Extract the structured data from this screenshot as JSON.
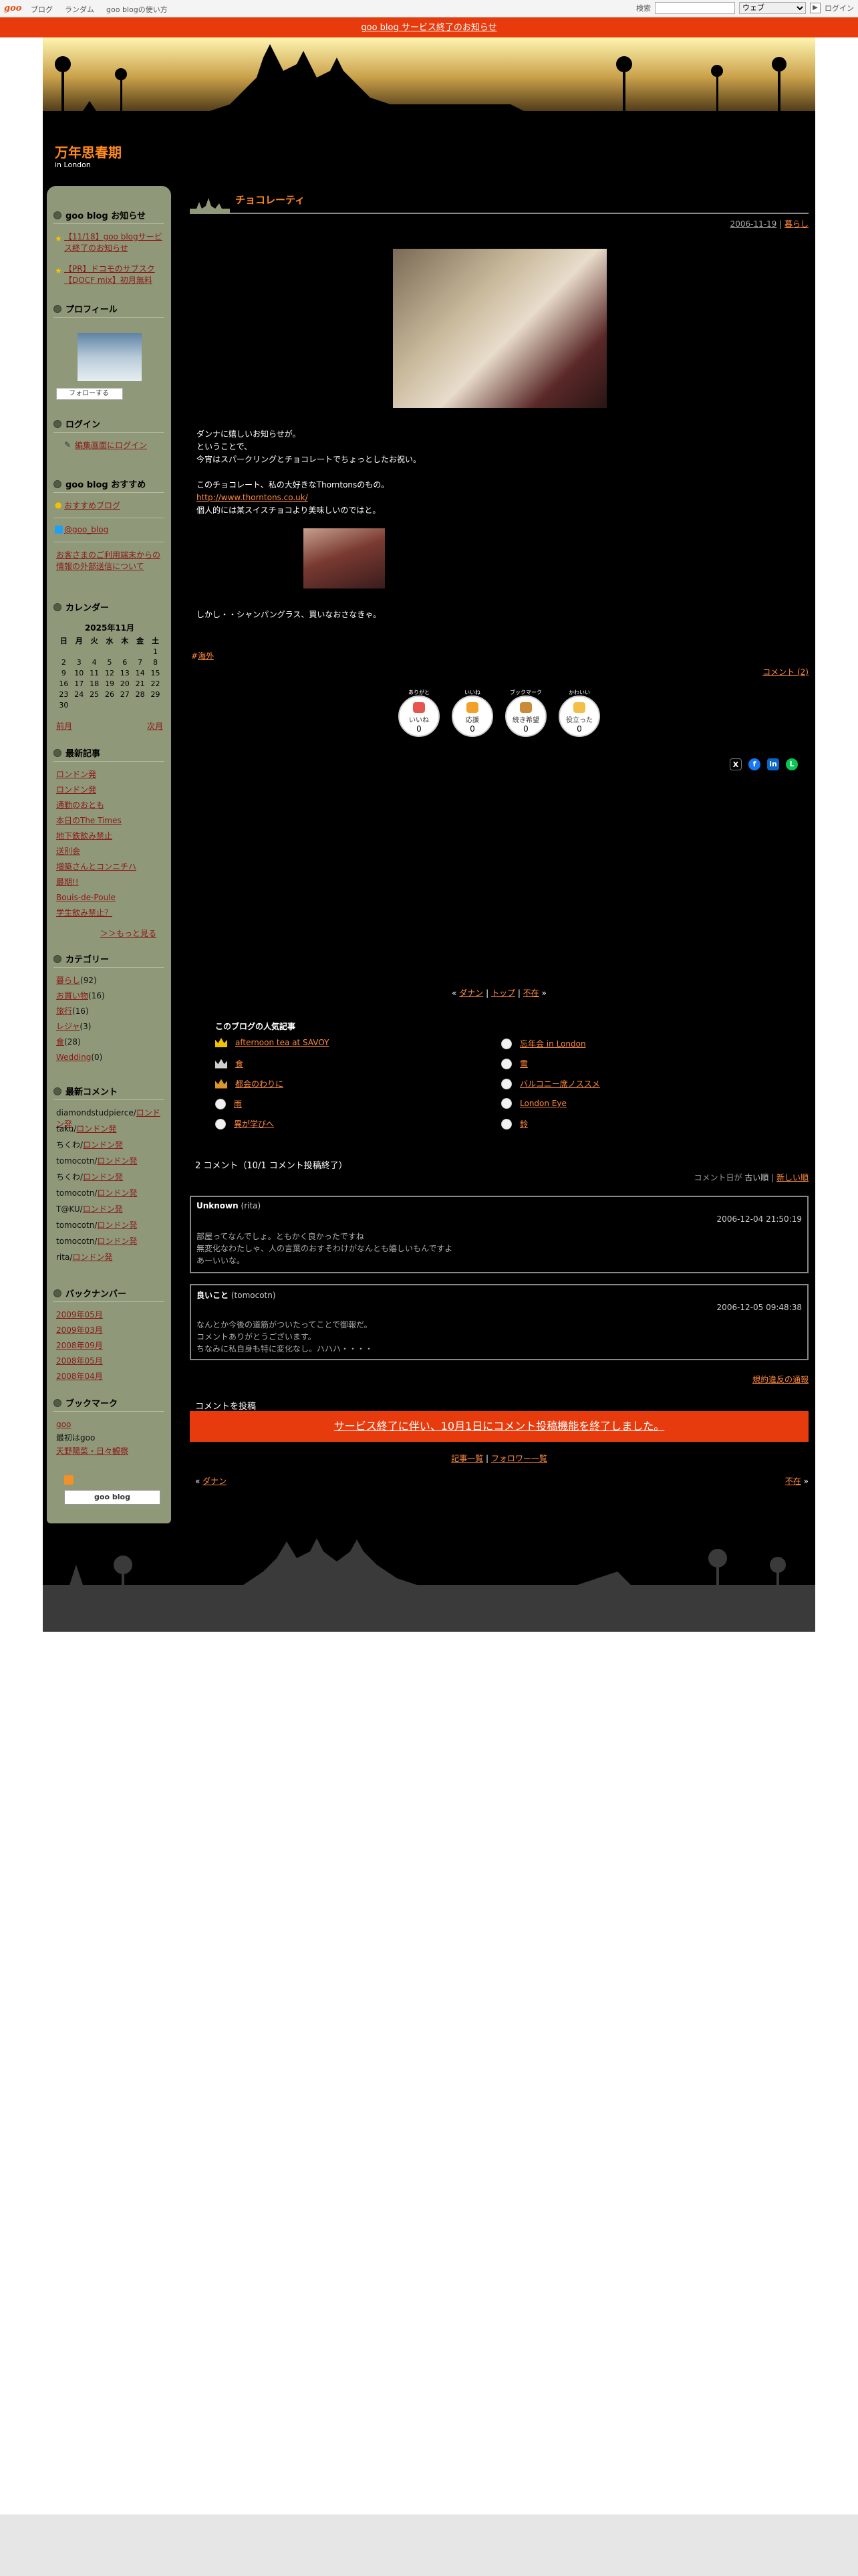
{
  "topbar": {
    "logo": "goo",
    "nav": [
      "ブログ",
      "ランダム",
      "goo blogの使い方"
    ],
    "search_label": "検索",
    "search_scope": "ウェブ",
    "login": "ログイン"
  },
  "notice": "goo blog サービス終了のお知らせ",
  "blog": {
    "title": "万年思春期",
    "subtitle": "in London"
  },
  "sidebar": {
    "notice_h": "goo blog お知らせ",
    "notices": [
      "【11/18】goo blogサービス終了のお知らせ",
      "【PR】ドコモのサブスク【DOCF mix】初月無料"
    ],
    "profile_h": "プロフィール",
    "follow": "フォローする",
    "login_h": "ログイン",
    "login_link": "編集画面にログイン",
    "recommend_h": "goo blog おすすめ",
    "recommend_link": "おすすめブログ",
    "x_link": "@goo_blog",
    "privacy_link": "お客さまのご利用端末からの情報の外部送信について",
    "calendar_h": "カレンダー",
    "calendar_month": "2025年11月",
    "calendar_days": [
      "日",
      "月",
      "火",
      "水",
      "木",
      "金",
      "土"
    ],
    "calendar_rows": [
      [
        "",
        "",
        "",
        "",
        "",
        "",
        "1"
      ],
      [
        "2",
        "3",
        "4",
        "5",
        "6",
        "7",
        "8"
      ],
      [
        "9",
        "10",
        "11",
        "12",
        "13",
        "14",
        "15"
      ],
      [
        "16",
        "17",
        "18",
        "19",
        "20",
        "21",
        "22"
      ],
      [
        "23",
        "24",
        "25",
        "26",
        "27",
        "28",
        "29"
      ],
      [
        "30",
        "",
        "",
        "",
        "",
        "",
        ""
      ]
    ],
    "cal_prev": "前月",
    "cal_next": "次月",
    "recent_h": "最新記事",
    "recent": [
      "ロンドン発",
      "ロンドン発",
      "通勤のおとも",
      "本日のThe Times",
      "地下鉄飲み禁止",
      "送別会",
      "増築さんとコンニチハ",
      "最期!!",
      "Bouis-de-Poule",
      "学生飲み禁止？"
    ],
    "more": "＞＞もっと見る",
    "category_h": "カテゴリー",
    "categories": [
      {
        "name": "暮らし",
        "count": "(92)"
      },
      {
        "name": "お買い物",
        "count": "(16)"
      },
      {
        "name": "旅行",
        "count": "(16)"
      },
      {
        "name": "レジャ",
        "count": "(3)"
      },
      {
        "name": "食",
        "count": "(28)"
      },
      {
        "name": "Wedding",
        "count": "(0)"
      }
    ],
    "comments_h": "最新コメント",
    "comments": [
      {
        "who": "diamondstudpierce/",
        "link": "ロンドン発"
      },
      {
        "who": "taku/",
        "link": "ロンドン発"
      },
      {
        "who": "ちくわ/",
        "link": "ロンドン発"
      },
      {
        "who": "tomocotn/",
        "link": "ロンドン発"
      },
      {
        "who": "ちくわ/",
        "link": "ロンドン発"
      },
      {
        "who": "tomocotn/",
        "link": "ロンドン発"
      },
      {
        "who": "T@KU/",
        "link": "ロンドン発"
      },
      {
        "who": "tomocotn/",
        "link": "ロンドン発"
      },
      {
        "who": "tomocotn/",
        "link": "ロンドン発"
      },
      {
        "who": "rita/",
        "link": "ロンドン発"
      }
    ],
    "backnumber_h": "バックナンバー",
    "backnumbers": [
      "2009年05月",
      "2009年03月",
      "2008年09月",
      "2008年05月",
      "2008年04月"
    ],
    "bookmark_h": "ブックマーク",
    "bookmarks": [
      "goo",
      "最初はgoo",
      "天野陽菜・日々観察"
    ],
    "goo_badge": "goo blog"
  },
  "entry": {
    "title": "チョコレーティ",
    "date": "2006-11-19",
    "category": "暮らし",
    "para1": [
      "ダンナに嬉しいお知らせが。",
      "ということで、",
      "今宵はスパークリングとチョコレートでちょっとしたお祝い。"
    ],
    "para2": [
      "このチョコレート、私の大好きなThorntonsのもの。"
    ],
    "url": "http://www.thorntons.co.uk/",
    "para3": [
      "個人的には某スイスチョコより美味しいのではと。"
    ],
    "para4": "しかし・・シャンパングラス、買いなおさなきゃ。",
    "tag": "海外",
    "comment_count": "コメント (2)"
  },
  "reactions": [
    {
      "top": "ありがと",
      "label": "いいね",
      "count": "0"
    },
    {
      "top": "いいね",
      "label": "応援",
      "count": "0"
    },
    {
      "top": "ブックマーク",
      "label": "続き希望",
      "count": "0"
    },
    {
      "top": "かわいい",
      "label": "役立った",
      "count": "0"
    }
  ],
  "pager": {
    "prev": "ダナン",
    "top": "トップ",
    "next": "不在"
  },
  "popular": {
    "heading": "このブログの人気記事",
    "left": [
      "afternoon tea at SAVOY",
      "食",
      "都会のわりに",
      "雨",
      "異が学びへ"
    ],
    "right": [
      "忘年会 in London",
      "雪",
      "バルコニー席ノススメ",
      "London Eye",
      "鈴"
    ]
  },
  "comments": {
    "heading": "2 コメント（10/1 コメント投稿終了）",
    "order": "コメント日が",
    "order_old": "古い順",
    "order_new": "新しい順",
    "items": [
      {
        "name": "Unknown",
        "handle": "(rita)",
        "date": "2006-12-04 21:50:19",
        "lines": [
          "部屋ってなんでしょ。ともかく良かったですね",
          "無変化なわたしゃ、人の言葉のおすそわけがなんとも嬉しいもんですよ",
          "あーいいな。"
        ]
      },
      {
        "name": "良いこと",
        "handle": "(tomocotn)",
        "date": "2006-12-05 09:48:38",
        "lines": [
          "なんとか今後の道筋がついたってことで御報だ。",
          "コメントありがとうございます。",
          "ちなみに私自身も特に変化なし。ハハハ・・・・"
        ]
      }
    ],
    "policy": "規約違反の通報",
    "post_h": "コメントを投稿",
    "banner": "サービス終了に伴い、10月1日にコメント投稿機能を終了しました。",
    "list": "記事一覧",
    "followers": "フォロワー一覧",
    "prev": "ダナン",
    "next": "不在"
  },
  "colors": {
    "accent": "#ff8a1d",
    "notice_bg": "#e83b0d",
    "sidebar_bg": "#8f9879"
  }
}
